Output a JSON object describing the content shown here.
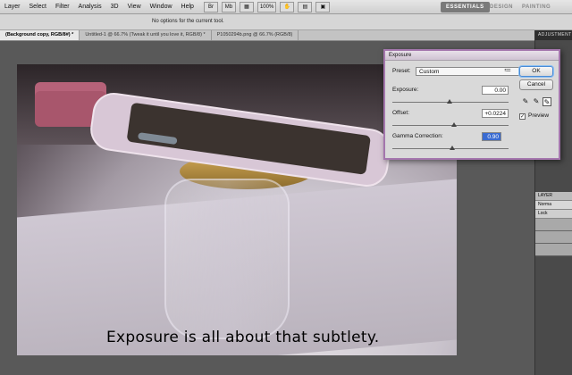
{
  "menu": [
    "Layer",
    "Select",
    "Filter",
    "Analysis",
    "3D",
    "View",
    "Window",
    "Help"
  ],
  "toolbar": {
    "zoom": "100%"
  },
  "workspaces": [
    "ESSENTIALS",
    "DESIGN",
    "PAINTING"
  ],
  "options_msg": "No options for the current tool.",
  "tabs": [
    "(Background copy, RGB/8#) *",
    "Untitled-1 @ 66.7% (Tweak it until you love it, RGB/8) *",
    "P1050294b.png @ 66.7% (RGB/8)"
  ],
  "right_panel": {
    "header": "ADJUSTMENTS",
    "layers_label": "LAYER",
    "blend_mode": "Norma",
    "lock_label": "Lock"
  },
  "photo_caption": "Exposure is all about that subtlety.",
  "dialog": {
    "title": "Exposure",
    "preset_label": "Preset:",
    "preset_value": "Custom",
    "exposure_label": "Exposure:",
    "exposure_value": "0.00",
    "offset_label": "Offset:",
    "offset_value": "+0.0224",
    "gamma_label": "Gamma Correction:",
    "gamma_value": "0.90",
    "ok_label": "OK",
    "cancel_label": "Cancel",
    "preview_label": "Preview",
    "preview_checked": true
  }
}
